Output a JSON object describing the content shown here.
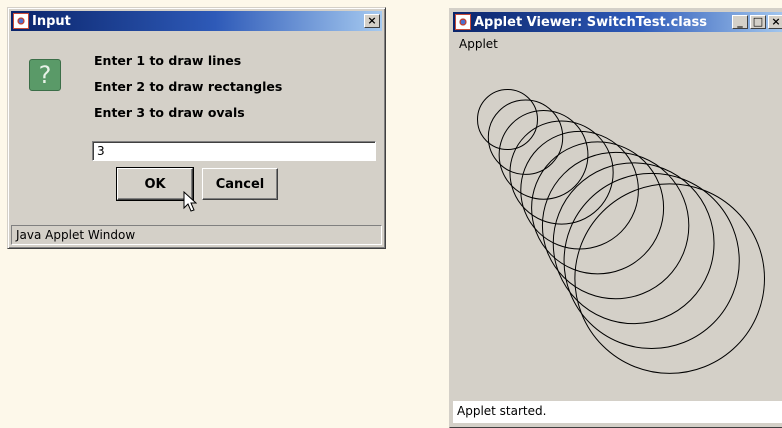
{
  "dialog": {
    "title": "Input",
    "close_label": "×",
    "icon": "question-icon",
    "icon_glyph": "?",
    "prompts": [
      "Enter 1 to draw lines",
      "Enter 2 to draw rectangles",
      "Enter 3 to draw ovals"
    ],
    "input_value": "3",
    "ok_label": "OK",
    "cancel_label": "Cancel",
    "status": "Java Applet Window"
  },
  "viewer": {
    "title": "Applet Viewer: SwitchTest.class",
    "minimize_label": "_",
    "maximize_label": "□",
    "close_label": "×",
    "menu": [
      "Applet"
    ],
    "status": "Applet started."
  }
}
